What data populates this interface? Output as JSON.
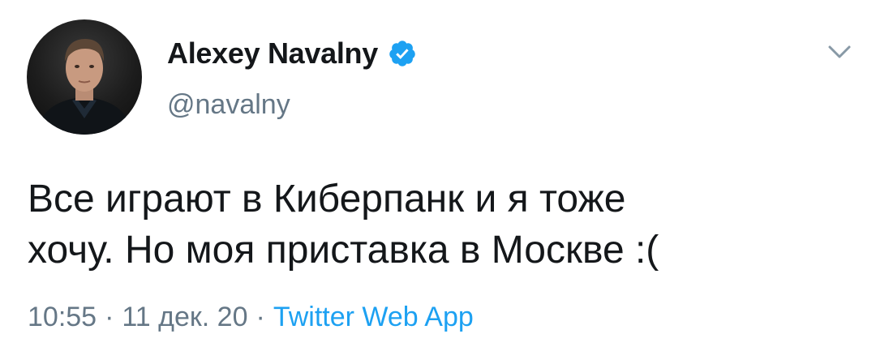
{
  "author": {
    "display_name": "Alexey Navalny",
    "handle": "@navalny",
    "verified": true,
    "avatar_icon": "profile-photo"
  },
  "tweet": {
    "text_lines": [
      "Все играют в Киберпанк и я тоже",
      "хочу. Но моя приставка в Москве :("
    ],
    "time": "10:55",
    "date": "11 дек. 20",
    "separator": "·",
    "source": "Twitter Web App"
  },
  "colors": {
    "text": "#14171a",
    "secondary": "#657786",
    "link": "#1da1f2",
    "verified": "#1da1f2"
  },
  "icons": {
    "verified": "verified-badge-icon",
    "menu": "chevron-down-icon"
  }
}
